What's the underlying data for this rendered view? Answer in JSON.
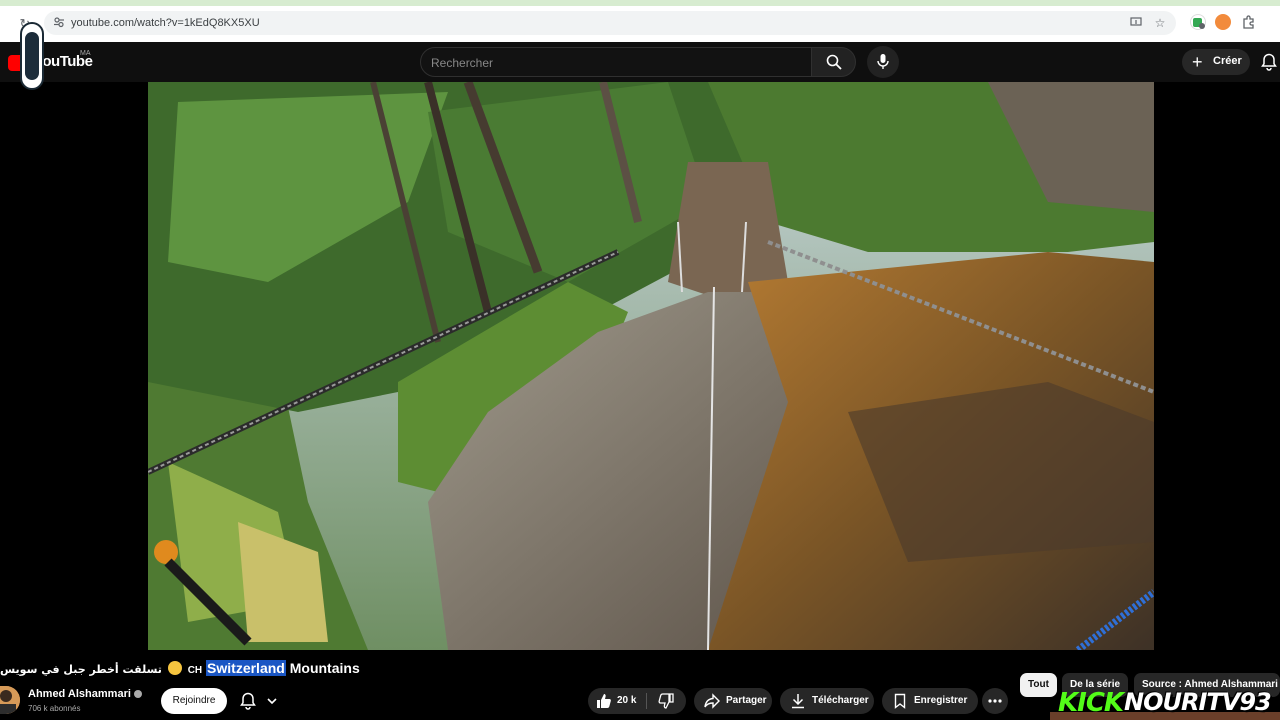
{
  "browser": {
    "url": "youtube.com/watch?v=1kEdQ8KX5XU"
  },
  "header": {
    "logo_text": "YouTube",
    "country": "MA",
    "search_placeholder": "Rechercher",
    "create_label": "Créer"
  },
  "video": {
    "title_arabic": "تسلقت أخطر جبل في سويس",
    "title_ch": "CH",
    "title_highlight": "Switzerland",
    "title_rest": "Mountains"
  },
  "channel": {
    "name": "Ahmed Alshammari",
    "subscribers": "706 k abonnés",
    "join_label": "Rejoindre"
  },
  "actions": {
    "likes": "20 k",
    "share": "Partager",
    "download": "Télécharger",
    "save": "Enregistrer"
  },
  "chips": [
    "Tout",
    "De la série",
    "Source : Ahmed Alshammari"
  ],
  "overlay": {
    "kick": "KICK",
    "streamer": "NOURITV93"
  },
  "colors": {
    "youtube_red": "#ff0000",
    "kick_green": "#53fc18",
    "title_highlight": "#1a56c4"
  }
}
